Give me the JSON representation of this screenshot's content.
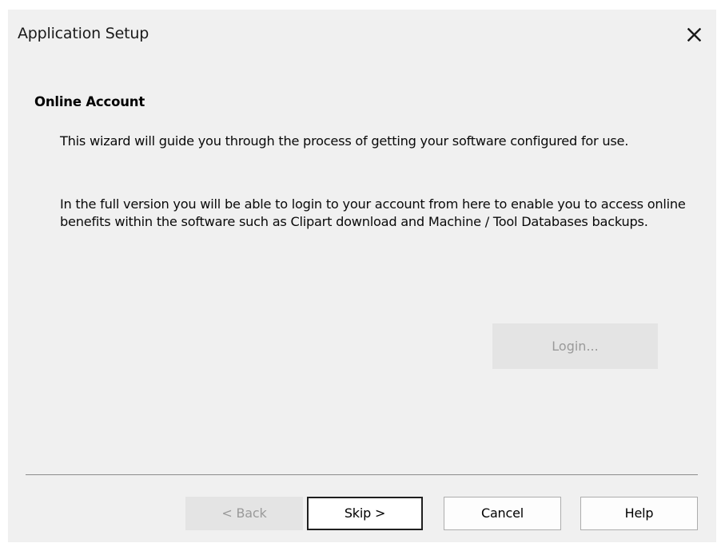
{
  "window": {
    "title": "Application Setup",
    "close_icon": "close-icon"
  },
  "content": {
    "section_title": "Online Account",
    "paragraph1": "This wizard will guide you through the process of getting your software configured for use.",
    "paragraph2": "In the full version you will be able to login to your account from here to enable you to access online benefits within the software such as Clipart download and Machine / Tool Databases backups.",
    "login_label": "Login..."
  },
  "footer": {
    "back_label": "< Back",
    "skip_label": "Skip >",
    "cancel_label": "Cancel",
    "help_label": "Help"
  },
  "colors": {
    "dialog_bg": "#f0f0f0",
    "disabled_text": "#9a9a9a",
    "disabled_bg": "#e4e4e4"
  }
}
